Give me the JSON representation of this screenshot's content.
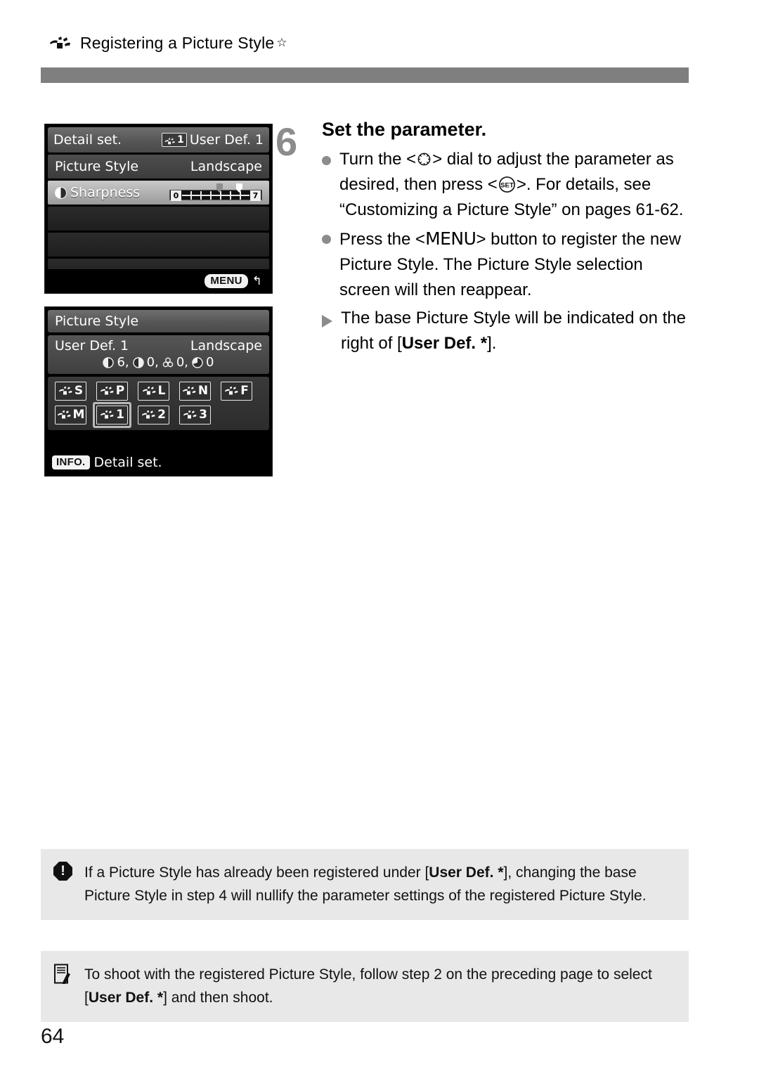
{
  "header": {
    "icon": "picture-style-icon",
    "title": "Registering a Picture Style",
    "star": "☆"
  },
  "screens": {
    "detail_set": {
      "title": "Detail set.",
      "badge": "1",
      "badge_label": "User Def. 1",
      "rows": [
        {
          "label": "Picture Style",
          "value": "Landscape"
        }
      ],
      "slider_row": {
        "icon": "sharpness-icon",
        "label": "Sharpness",
        "min": "0",
        "max": "7",
        "original_value": 4,
        "current_value": 6
      },
      "footer_badge": "MENU",
      "footer_arrow": "↰"
    },
    "picture_style": {
      "title": "Picture Style",
      "selected_name": "User Def. 1",
      "base_style": "Landscape",
      "params": [
        {
          "icon": "sharpness-icon",
          "value": "6,"
        },
        {
          "icon": "contrast-icon",
          "value": "0,"
        },
        {
          "icon": "saturation-icon",
          "value": "0,"
        },
        {
          "icon": "color-tone-icon",
          "value": "0"
        }
      ],
      "grid": [
        [
          {
            "code": "S",
            "name": "standard",
            "selected": false
          },
          {
            "code": "P",
            "name": "portrait",
            "selected": false
          },
          {
            "code": "L",
            "name": "landscape",
            "selected": false
          },
          {
            "code": "N",
            "name": "neutral",
            "selected": false
          },
          {
            "code": "F",
            "name": "faithful",
            "selected": false
          }
        ],
        [
          {
            "code": "M",
            "name": "monochrome",
            "selected": false
          },
          {
            "code": "1",
            "name": "user-def-1",
            "selected": true
          },
          {
            "code": "2",
            "name": "user-def-2",
            "selected": false
          },
          {
            "code": "3",
            "name": "user-def-3",
            "selected": false
          }
        ]
      ],
      "footer_badge": "INFO.",
      "footer_label": "Detail set."
    }
  },
  "step": {
    "number": "6",
    "title": "Set the parameter.",
    "bullet1_part1": "Turn the <",
    "bullet1_part2": "> dial to adjust the parameter as desired, then press <",
    "bullet1_part3": ">.",
    "bullet1_line2": "For details, see “Customizing a Picture Style” on pages 61-62.",
    "bullet2_part1": "Press the <",
    "bullet2_menu": "MENU",
    "bullet2_part2": "> button to register the new Picture Style. The Picture Style selection screen will then reappear.",
    "bullet3_part1": "The base Picture Style will be indicated on the right of [",
    "bullet3_bold": "User Def. *",
    "bullet3_part2": "]."
  },
  "notes": {
    "caution": {
      "icon": "caution-icon",
      "text_part1": "If a Picture Style has already been registered under [",
      "bold1": "User Def. *",
      "text_part2": "], changing the base Picture Style in step 4 will nullify the parameter settings of the registered Picture Style."
    },
    "memo": {
      "icon": "note-icon",
      "text_part1": "To shoot with the registered Picture Style, follow step 2 on the preceding page to select [",
      "bold1": "User Def. *",
      "text_part2": "] and then shoot."
    }
  },
  "page_number": "64"
}
